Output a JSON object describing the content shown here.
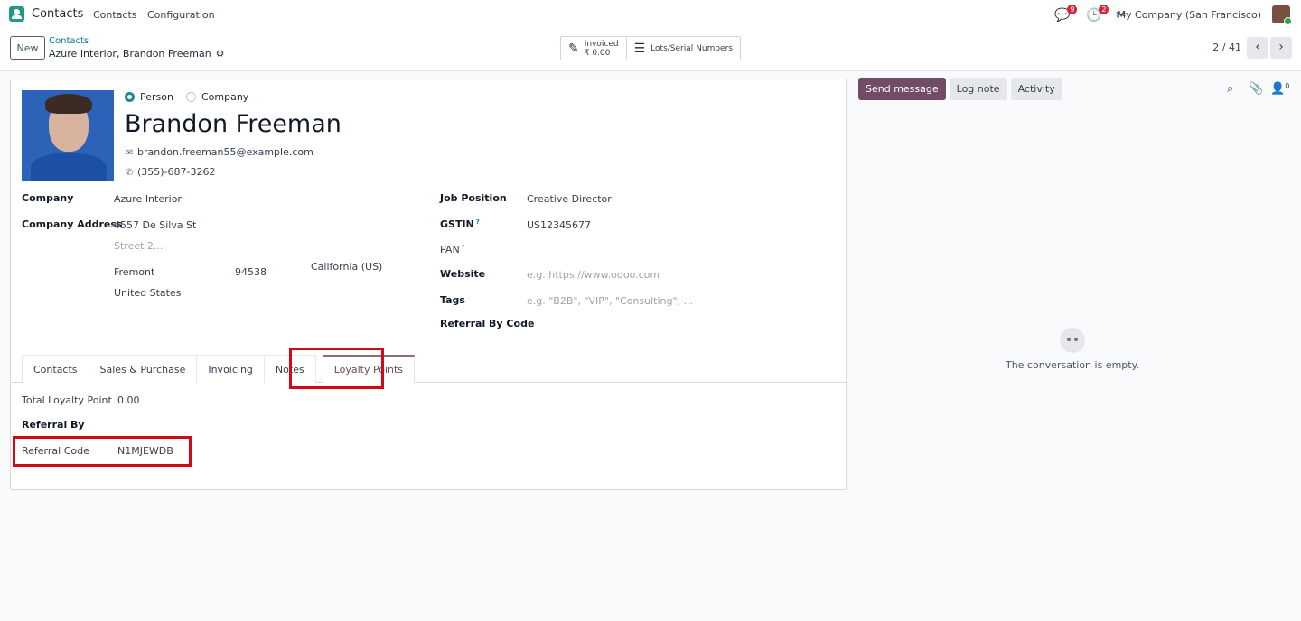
{
  "navbar": {
    "app_name": "Contacts",
    "menu": [
      "Contacts",
      "Configuration"
    ],
    "messages_count": "9",
    "activities_count": "2",
    "company": "My Company (San Francisco)"
  },
  "control_panel": {
    "new_label": "New",
    "breadcrumb": "Contacts",
    "record_name": "Azure Interior, Brandon Freeman",
    "smart_buttons": {
      "invoiced_label": "Invoiced",
      "invoiced_value": "₹ 0.00",
      "lots_label": "Lots/Serial Numbers"
    },
    "pager": "2 / 41"
  },
  "form": {
    "type_options": [
      "Person",
      "Company"
    ],
    "selected_type": "Person",
    "name": "Brandon Freeman",
    "email": "brandon.freeman55@example.com",
    "phone": "(355)-687-3262",
    "left_fields": {
      "company_label": "Company",
      "company_value": "Azure Interior",
      "address_label": "Company Address",
      "street": "4557 De Silva St",
      "street2_placeholder": "Street 2...",
      "city": "Fremont",
      "zip": "94538",
      "state": "California (US)",
      "country": "United States"
    },
    "right_fields": {
      "job_label": "Job Position",
      "job_value": "Creative Director",
      "gstin_label": "GSTIN",
      "gstin_help": "?",
      "gstin_value": "US12345677",
      "pan_label": "PAN",
      "pan_help": "?",
      "website_label": "Website",
      "website_placeholder": "e.g. https://www.odoo.com",
      "tags_label": "Tags",
      "tags_placeholder": "e.g. \"B2B\", \"VIP\", \"Consulting\", ...",
      "referral_by_code_label": "Referral By Code"
    },
    "tabs": [
      "Contacts",
      "Sales & Purchase",
      "Invoicing",
      "Notes",
      "Loyalty Points"
    ],
    "active_tab": "Loyalty Points",
    "loyalty": {
      "total_label": "Total Loyalty Point",
      "total_value": "0.00",
      "referral_by_label": "Referral By",
      "referral_code_label": "Referral Code",
      "referral_code_value": "N1MJEWDB"
    }
  },
  "chatter": {
    "send_message": "Send message",
    "log_note": "Log note",
    "activity": "Activity",
    "followers_count": "0",
    "empty_text": "The conversation is empty."
  },
  "colors": {
    "brand": "#714b67",
    "link": "#017e84",
    "highlight": "#d20a17",
    "badge": "#d12a3f"
  }
}
